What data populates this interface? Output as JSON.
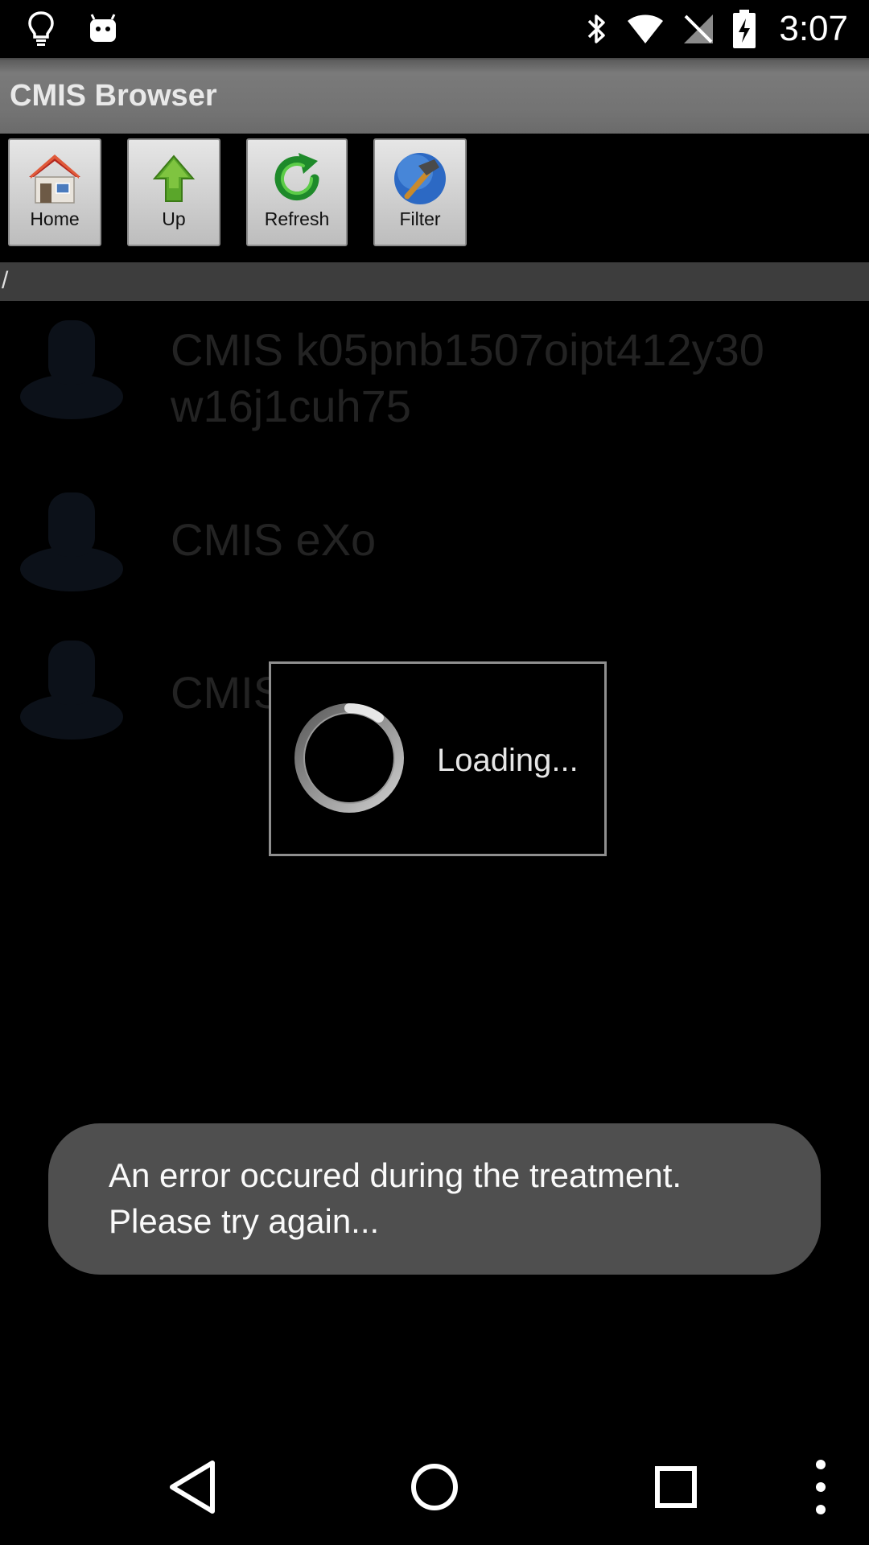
{
  "status_bar": {
    "time": "3:07",
    "left_icons": [
      "lightbulb-icon",
      "android-icon"
    ],
    "right_icons": [
      "bluetooth-icon",
      "wifi-icon",
      "no-sim-icon",
      "battery-charging-icon"
    ]
  },
  "app": {
    "title": "CMIS Browser"
  },
  "toolbar": {
    "buttons": [
      {
        "label": "Home",
        "icon": "home-icon"
      },
      {
        "label": "Up",
        "icon": "arrow-up-icon"
      },
      {
        "label": "Refresh",
        "icon": "refresh-icon"
      },
      {
        "label": "Filter",
        "icon": "hammer-icon"
      }
    ]
  },
  "path": "/",
  "list": {
    "items": [
      {
        "label": "CMIS k05pnb1507oipt412y30 w16j1cuh75",
        "icon": "server-icon"
      },
      {
        "label": "CMIS eXo",
        "icon": "server-icon"
      },
      {
        "label": "CMIS",
        "icon": "server-icon"
      }
    ]
  },
  "dialog": {
    "message": "Loading..."
  },
  "toast": {
    "message": "An error occured during the treatment.\nPlease try again..."
  },
  "colors": {
    "title_bar": "#737373",
    "toast_bg": "#4f4f4f",
    "path_bar": "#3d3d3d"
  }
}
